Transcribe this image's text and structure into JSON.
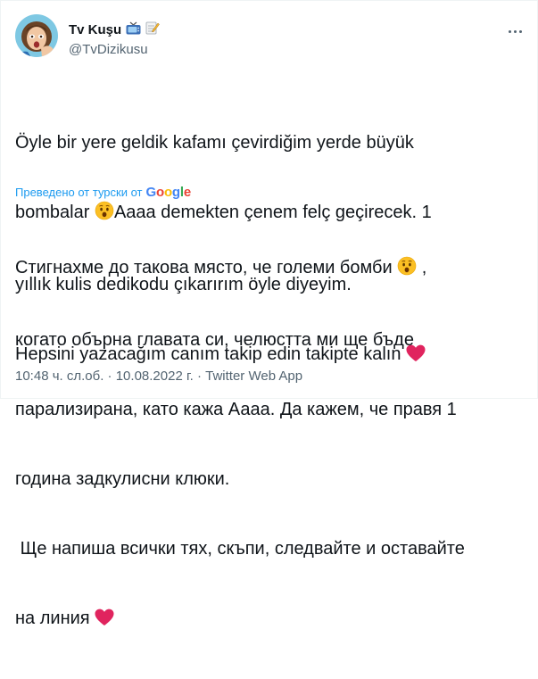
{
  "author": {
    "display_name": "Tv Kuşu",
    "handle": "@TvDizikusu",
    "badge_icons": [
      "tv-icon",
      "memo-icon"
    ]
  },
  "tweet": {
    "original_lines": [
      "Öyle bir yere geldik kafamı çevirdiğim yerde büyük",
      "bombalar",
      "Aaaa demekten çenem felç geçirecek. 1",
      "yıllık kulis dedikodu çıkarırım öyle diyeyim.",
      "Hepsini yazacağım canım takip edin takipte kalın"
    ],
    "translated_by": "Преведено от турски от",
    "google": [
      "G",
      "o",
      "o",
      "g",
      "l",
      "e"
    ],
    "google_colors": [
      "#4285f4",
      "#ea4335",
      "#fbbc05",
      "#4285f4",
      "#34a853",
      "#ea4335"
    ],
    "translation_lines": [
      "Стигнахме до такова място, че големи бомби",
      ",",
      "когато обърна главата си, челюстта ми ще бъде",
      "парализирана, като кажа Аааа. Да кажем, че правя 1",
      "година задкулисни клюки.",
      " Ще напиша всички тях, скъпи, следвайте и оставайте",
      "на линия"
    ],
    "timestamp": "10:48 ч. сл.об.",
    "date": "10.08.2022 г.",
    "source": "Twitter Web App",
    "separator": "·"
  },
  "emojis": {
    "surprised": "hushed-face-icon",
    "heart": "red-heart-icon"
  }
}
